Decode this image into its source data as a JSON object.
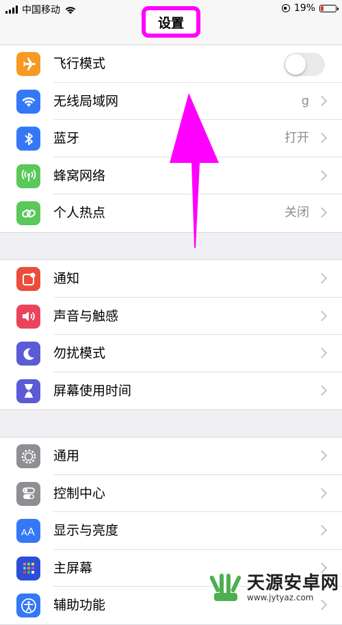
{
  "status_bar": {
    "carrier": "中国移动",
    "battery_text": "19%",
    "battery_level": 0.19
  },
  "nav": {
    "title": "设置"
  },
  "groups": [
    {
      "rows": [
        {
          "label": "飞行模式",
          "icon": "airplane-icon",
          "color": "#f59a23",
          "toggle": false
        },
        {
          "label": "无线局域网",
          "icon": "wifi-icon",
          "color": "#3478f6",
          "value": "g"
        },
        {
          "label": "蓝牙",
          "icon": "bluetooth-icon",
          "color": "#3478f6",
          "value": "打开"
        },
        {
          "label": "蜂窝网络",
          "icon": "cellular-icon",
          "color": "#5ac85a"
        },
        {
          "label": "个人热点",
          "icon": "hotspot-icon",
          "color": "#5ac85a",
          "value": "关闭"
        }
      ]
    },
    {
      "rows": [
        {
          "label": "通知",
          "icon": "notifications-icon",
          "color": "#eb4d3d"
        },
        {
          "label": "声音与触感",
          "icon": "sound-icon",
          "color": "#eb445a"
        },
        {
          "label": "勿扰模式",
          "icon": "moon-icon",
          "color": "#5b5bd6"
        },
        {
          "label": "屏幕使用时间",
          "icon": "hourglass-icon",
          "color": "#5b5bd6"
        }
      ]
    },
    {
      "rows": [
        {
          "label": "通用",
          "icon": "gear-icon",
          "color": "#8e8e93"
        },
        {
          "label": "控制中心",
          "icon": "control-center-icon",
          "color": "#8e8e93"
        },
        {
          "label": "显示与亮度",
          "icon": "display-icon",
          "color": "#3478f6"
        },
        {
          "label": "主屏幕",
          "icon": "home-screen-icon",
          "color": "#2d4fd6"
        },
        {
          "label": "辅助功能",
          "icon": "accessibility-icon",
          "color": "#3478f6"
        }
      ]
    }
  ],
  "watermark": {
    "main": "天源安卓网",
    "sub": "www.jytyaz.com"
  },
  "annotation": {
    "highlight_color": "#ff00ff"
  }
}
